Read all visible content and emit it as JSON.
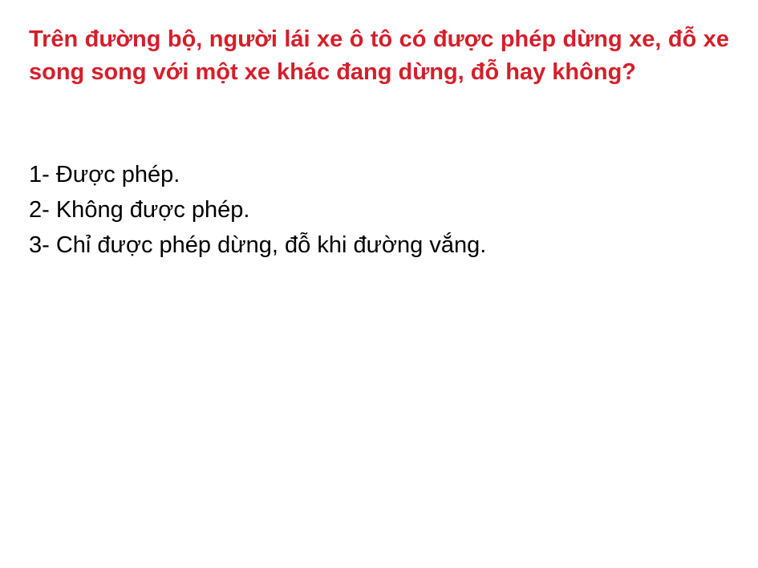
{
  "question": "Trên đường bộ, người lái xe ô tô có được phép dừng xe, đỗ xe song song với một xe khác đang dừng, đỗ hay không?",
  "answers": [
    "1- Được phép.",
    "2- Không được phép.",
    "3- Chỉ được phép dừng, đỗ khi đường vắng."
  ],
  "colors": {
    "question": "#d41f2b",
    "answers": "#000000",
    "background": "#ffffff"
  }
}
